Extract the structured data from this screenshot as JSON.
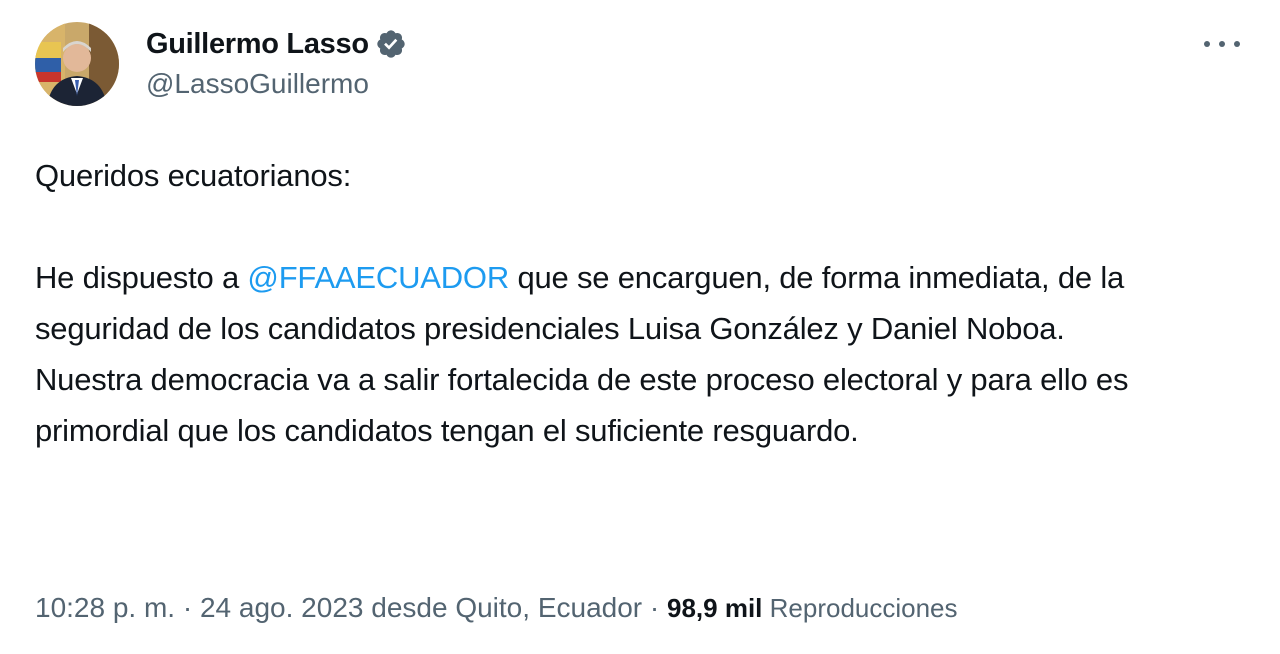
{
  "author": {
    "display_name": "Guillermo Lasso",
    "handle": "@LassoGuillermo",
    "verified": true
  },
  "tweet": {
    "line1": "Queridos ecuatorianos:",
    "p2_pre": "He dispuesto a ",
    "mention": "@FFAAECUADOR",
    "p2_post": " que se encarguen, de forma inmediata, de la seguridad de los candidatos presidenciales Luisa González y Daniel Noboa.",
    "p3": "Nuestra democracia va a salir fortalecida de este proceso electoral y para ello es primordial que los candidatos tengan el suficiente resguardo."
  },
  "meta": {
    "time": "10:28 p. m.",
    "sep1": " · ",
    "date": "24 ago. 2023",
    "location": " desde Quito, Ecuador",
    "sep2": " · ",
    "views_count": "98,9 mil",
    "views_label": " Reproducciones"
  },
  "colors": {
    "accent": "#1d9bf0",
    "secondary_text": "#536471",
    "primary_text": "#0f1419"
  },
  "icons": {
    "verified": "verified-badge-icon",
    "more": "more-options-icon"
  }
}
